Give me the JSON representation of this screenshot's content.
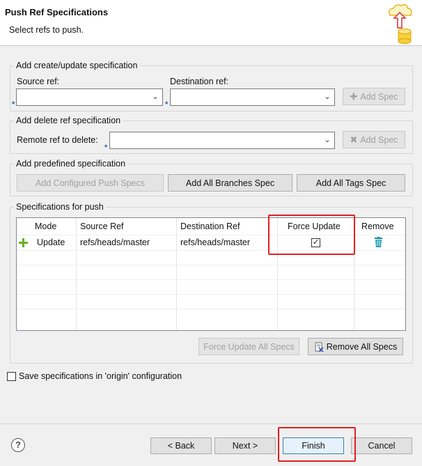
{
  "dialog": {
    "title": "Push Ref Specifications",
    "subtitle": "Select refs to push."
  },
  "create_update": {
    "legend": "Add create/update specification",
    "source_label": "Source ref:",
    "source_value": "",
    "dest_label": "Destination ref:",
    "dest_value": "",
    "add_spec": "Add Spec"
  },
  "delete_ref": {
    "legend": "Add delete ref specification",
    "remote_label": "Remote ref to delete:",
    "remote_value": "",
    "add_spec": "Add Spec"
  },
  "predefined": {
    "legend": "Add predefined specification",
    "configured": "Add Configured Push Specs",
    "all_branches": "Add All Branches Spec",
    "all_tags": "Add All Tags Spec"
  },
  "specs": {
    "legend": "Specifications for push",
    "columns": [
      "Mode",
      "Source Ref",
      "Destination Ref",
      "Force Update",
      "Remove"
    ],
    "rows": [
      {
        "mode": "Update",
        "source": "refs/heads/master",
        "destination": "refs/heads/master",
        "force_update": true
      }
    ],
    "force_all": "Force Update All Specs",
    "remove_all": "Remove All Specs"
  },
  "save_config_label": "Save specifications in 'origin' configuration",
  "save_config_checked": false,
  "nav": {
    "back": "< Back",
    "next": "Next >",
    "finish": "Finish",
    "cancel": "Cancel"
  },
  "colors": {
    "highlight": "#e02020",
    "add_icon": "#6ab023",
    "remove_icon": "#1a8a9a"
  }
}
